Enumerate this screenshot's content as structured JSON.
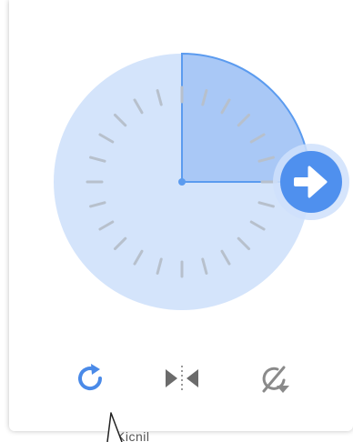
{
  "dial": {
    "rotation_handle_icon": "arrow-right-icon",
    "tick_count": 24,
    "colors": {
      "face": "#d4e4fb",
      "sector_fill": "#a9c8f6",
      "sector_stroke": "#5b9bef",
      "tick": "#b7c0cc",
      "handle": "#4f90ee",
      "handle_halo": "#cfe1fb",
      "icon_white": "#ffffff"
    }
  },
  "toolbar": {
    "items": [
      {
        "icon": "rotate-clockwise-icon",
        "color": "#4a8ae8",
        "active": true
      },
      {
        "icon": "flip-horizontal-icon",
        "color": "#6b6b6b",
        "active": false
      },
      {
        "icon": "reset-rotation-icon",
        "color": "#8a8a8a",
        "active": false
      }
    ]
  },
  "background_text": "Kicnil"
}
